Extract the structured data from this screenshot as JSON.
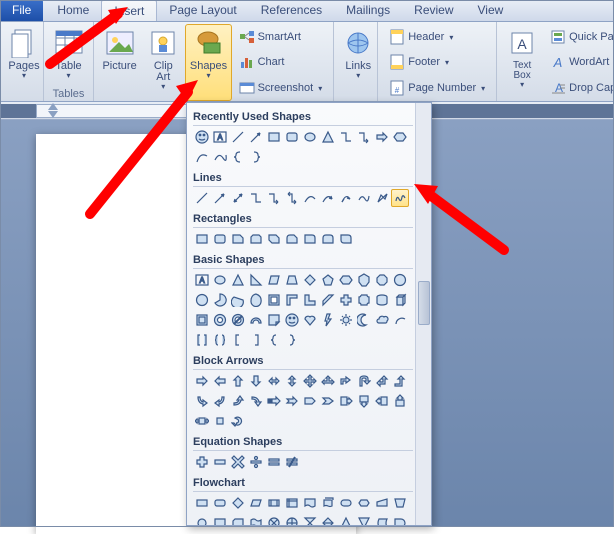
{
  "tabs": {
    "file": "File",
    "home": "Home",
    "insert": "Insert",
    "pageLayout": "Page Layout",
    "references": "References",
    "mailings": "Mailings",
    "review": "Review",
    "view": "View"
  },
  "ribbon": {
    "pages": {
      "label": "Pages",
      "btn": "Pages"
    },
    "tables": {
      "label": "Tables",
      "btn": "Table"
    },
    "illustrations": {
      "picture": "Picture",
      "clipArt": "Clip Art",
      "shapes": "Shapes",
      "smartArt": "SmartArt",
      "chart": "Chart",
      "screenshot": "Screenshot"
    },
    "links": {
      "btn": "Links"
    },
    "headerFooter": {
      "header": "Header",
      "footer": "Footer",
      "pageNumber": "Page Number"
    },
    "text": {
      "textBox": "Text Box",
      "quickParts": "Quick Parts",
      "wordArt": "WordArt",
      "dropCap": "Drop Cap"
    }
  },
  "shapesMenu": {
    "categories": {
      "recent": "Recently Used Shapes",
      "lines": "Lines",
      "rectangles": "Rectangles",
      "basic": "Basic Shapes",
      "blockArrows": "Block Arrows",
      "equation": "Equation Shapes",
      "flowchart": "Flowchart"
    }
  },
  "highlighted": {
    "tab": "insert",
    "ribbonButton": "shapes",
    "shapeInGallery": "freeform-scribble"
  }
}
